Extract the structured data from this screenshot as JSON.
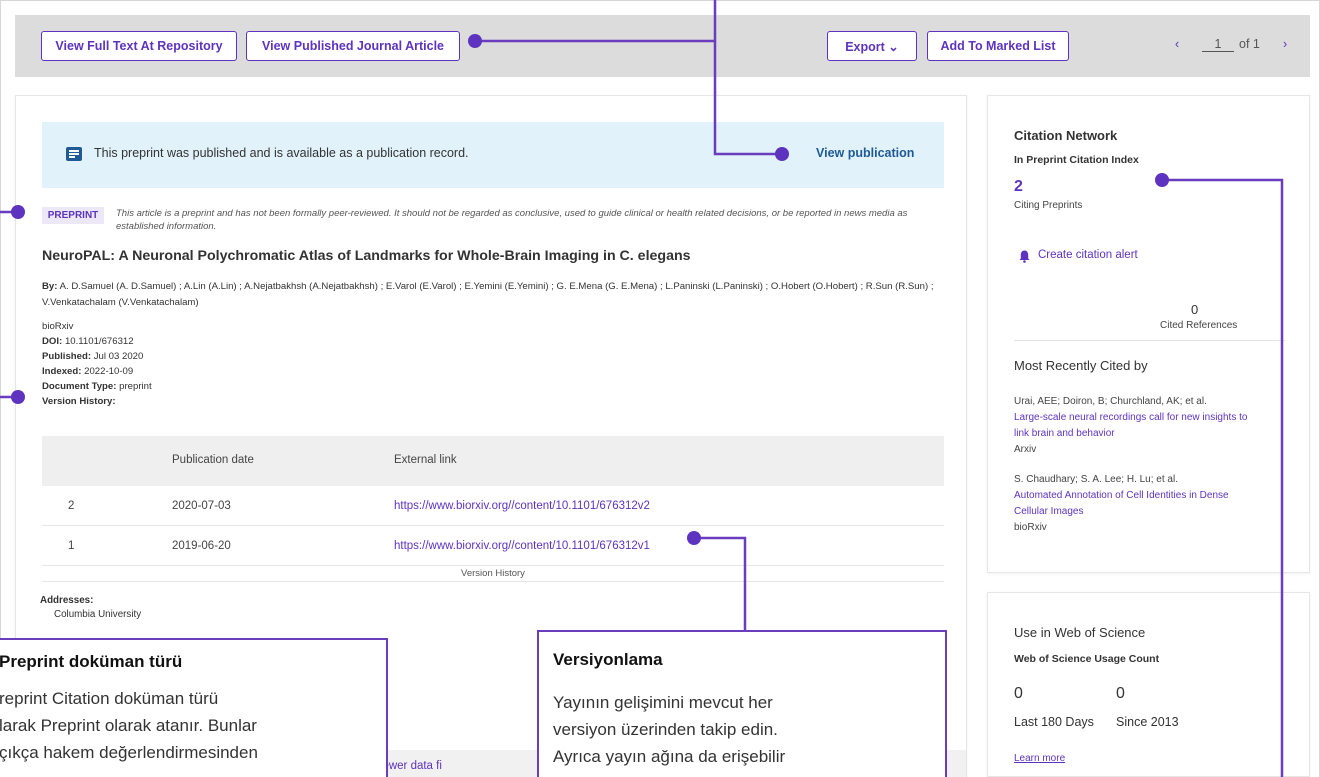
{
  "toolbar": {
    "full_text_label": "View Full Text At Repository",
    "published_article_label": "View Published Journal Article",
    "export_label": "Export ⌄",
    "marked_list_label": "Add To Marked List",
    "pager": {
      "prev": "‹",
      "page": "1",
      "of": "of 1",
      "next": "›"
    }
  },
  "banner": {
    "text": "This preprint was published and is available as a publication record.",
    "link": "View publication"
  },
  "record": {
    "badge": "PREPRINT",
    "note": "This article is a preprint and has not been formally peer-reviewed. It should not be regarded as conclusive, used to guide clinical or health related decisions, or be reported in news media as established information.",
    "title": "NeuroPAL: A Neuronal Polychromatic Atlas of Landmarks for Whole-Brain Imaging in C. elegans",
    "by_label": "By:",
    "authors": "A. D.Samuel (A. D.Samuel) ; A.Lin (A.Lin) ; A.Nejatbakhsh (A.Nejatbakhsh) ; E.Varol (E.Varol) ; E.Yemini (E.Yemini) ; G. E.Mena (G. E.Mena) ; L.Paninski (L.Paninski) ; O.Hobert (O.Hobert) ; R.Sun (R.Sun) ; V.Venkatachalam (V.Venkatachalam)",
    "source": "bioRxiv",
    "doi_label": "DOI:",
    "doi": "10.1101/676312",
    "published_label": "Published:",
    "published": "Jul 03 2020",
    "indexed_label": "Indexed:",
    "indexed": "2022-10-09",
    "doctype_label": "Document Type:",
    "doctype": "preprint",
    "version_history_label": "Version History:"
  },
  "versions": {
    "headers": [
      "Publication date",
      "External link"
    ],
    "rows": [
      {
        "num": "2",
        "date": "2020-07-03",
        "link": "https://www.biorxiv.org//content/10.1101/676312v2"
      },
      {
        "num": "1",
        "date": "2019-06-20",
        "link": "https://www.biorxiv.org//content/10.1101/676312v1"
      }
    ],
    "caption": "Version History"
  },
  "addresses": {
    "label": "Addresses:",
    "value": "Columbia University"
  },
  "see_fewer": "– See fewer data fi",
  "citation": {
    "heading": "Citation Network",
    "index": "In Preprint Citation Index",
    "count": "2",
    "count_label": "Citing Preprints",
    "alert": "Create citation alert",
    "refs_count": "0",
    "refs_label": "Cited References",
    "recent_heading": "Most Recently Cited by",
    "items": [
      {
        "authors": "Urai, AEE; Doiron, B; Churchland, AK; et al.",
        "title1": "Large-scale neural recordings call for new insights to",
        "title2": "link brain and behavior",
        "source": "Arxiv"
      },
      {
        "authors": "S. Chaudhary; S. A. Lee; H. Lu; et al.",
        "title1": "Automated Annotation of Cell Identities in Dense",
        "title2": "Cellular Images",
        "source": "bioRxiv"
      }
    ]
  },
  "usage": {
    "heading": "Use in Web of Science",
    "sub": "Web of Science Usage Count",
    "last180": "0",
    "last180_label": "Last 180 Days",
    "since2013": "0",
    "since2013_label": "Since 2013",
    "learn_more": "Learn more"
  },
  "callouts": {
    "preprint": {
      "title": "Preprint doküman türü",
      "line1": "reprint Citation doküman türü",
      "line2": "larak Preprint olarak atanır.  Bunlar",
      "line3": "çıkça hakem değerlendirmesinden"
    },
    "versioning": {
      "title": "Versiyonlama",
      "line1": "Yayının gelişimini mevcut her",
      "line2": "versiyon üzerinden takip edin.",
      "line3": "Ayrıca yayın ağına da erişebilir"
    }
  },
  "colors": {
    "accent": "#5e33bf",
    "callout_border": "#6a3dbf",
    "banner_bg": "#e1f2fa",
    "toolbar_bg": "#dcdcdc"
  }
}
